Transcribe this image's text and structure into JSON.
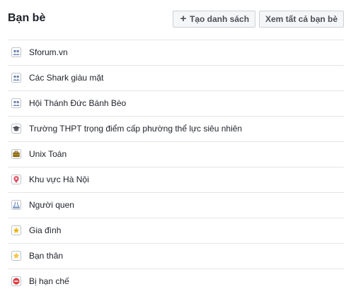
{
  "header": {
    "title": "Bạn bè",
    "create_list_label": "Tạo danh sách",
    "view_all_label": "Xem tất cả bạn bè"
  },
  "lists": [
    {
      "label": "Sforum.vn",
      "icon": "group-icon"
    },
    {
      "label": "Các Shark giàu mặt",
      "icon": "group-icon"
    },
    {
      "label": "Hội Thánh Đức Bánh Bèo",
      "icon": "group-icon"
    },
    {
      "label": "Trường THPT trọng điểm cấp phường thể lực siêu nhiên",
      "icon": "graduation-cap-icon"
    },
    {
      "label": "Unix Toán",
      "icon": "briefcase-icon"
    },
    {
      "label": "Khu vực Hà Nội",
      "icon": "location-pin-icon"
    },
    {
      "label": "Người quen",
      "icon": "acquaintance-icon"
    },
    {
      "label": "Gia đình",
      "icon": "family-house-icon"
    },
    {
      "label": "Bạn thân",
      "icon": "star-icon"
    },
    {
      "label": "Bị hạn chế",
      "icon": "restricted-icon"
    }
  ],
  "colors": {
    "group": "#6d84b4",
    "graduation": "#4b4f56",
    "briefcase": "#8b6914",
    "pin": "#e05567",
    "acquaintance": "#6d84b4",
    "family": "#e8b400",
    "star": "#f5c33b",
    "restricted": "#e0393e",
    "divider": "#e5e5e5"
  }
}
